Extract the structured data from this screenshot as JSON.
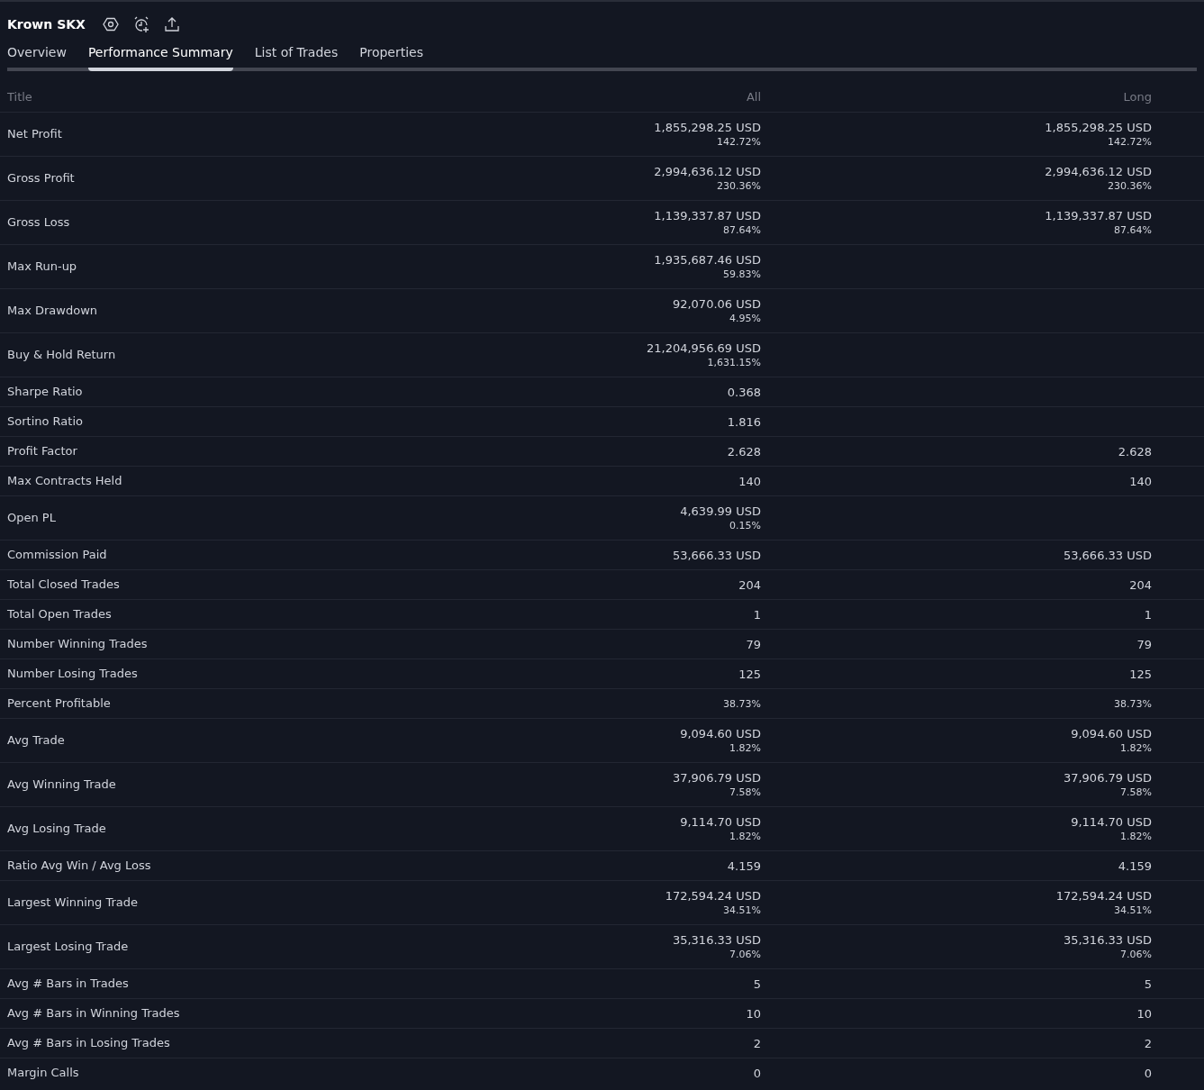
{
  "header": {
    "title": "Krown SKX"
  },
  "tabs": [
    {
      "label": "Overview",
      "selected": false
    },
    {
      "label": "Performance Summary",
      "selected": true
    },
    {
      "label": "List of Trades",
      "selected": false
    },
    {
      "label": "Properties",
      "selected": false
    }
  ],
  "table": {
    "columns": [
      "Title",
      "All",
      "Long"
    ],
    "rows": [
      {
        "title": "Net Profit",
        "all": {
          "value": "1,855,298.25 USD",
          "percent": "142.72%"
        },
        "long": {
          "value": "1,855,298.25 USD",
          "percent": "142.72%"
        }
      },
      {
        "title": "Gross Profit",
        "all": {
          "value": "2,994,636.12 USD",
          "percent": "230.36%"
        },
        "long": {
          "value": "2,994,636.12 USD",
          "percent": "230.36%"
        }
      },
      {
        "title": "Gross Loss",
        "all": {
          "value": "1,139,337.87 USD",
          "percent": "87.64%"
        },
        "long": {
          "value": "1,139,337.87 USD",
          "percent": "87.64%"
        }
      },
      {
        "title": "Max Run-up",
        "all": {
          "value": "1,935,687.46 USD",
          "percent": "59.83%"
        }
      },
      {
        "title": "Max Drawdown",
        "all": {
          "value": "92,070.06 USD",
          "percent": "4.95%"
        }
      },
      {
        "title": "Buy & Hold Return",
        "all": {
          "value": "21,204,956.69 USD",
          "percent": "1,631.15%"
        }
      },
      {
        "title": "Sharpe Ratio",
        "all": {
          "value": "0.368"
        }
      },
      {
        "title": "Sortino Ratio",
        "all": {
          "value": "1.816"
        }
      },
      {
        "title": "Profit Factor",
        "all": {
          "value": "2.628"
        },
        "long": {
          "value": "2.628"
        }
      },
      {
        "title": "Max Contracts Held",
        "all": {
          "value": "140"
        },
        "long": {
          "value": "140"
        }
      },
      {
        "title": "Open PL",
        "all": {
          "value": "4,639.99 USD",
          "percent": "0.15%"
        }
      },
      {
        "title": "Commission Paid",
        "all": {
          "value": "53,666.33 USD"
        },
        "long": {
          "value": "53,666.33 USD"
        }
      },
      {
        "title": "Total Closed Trades",
        "all": {
          "value": "204"
        },
        "long": {
          "value": "204"
        }
      },
      {
        "title": "Total Open Trades",
        "all": {
          "value": "1"
        },
        "long": {
          "value": "1"
        }
      },
      {
        "title": "Number Winning Trades",
        "all": {
          "value": "79"
        },
        "long": {
          "value": "79"
        }
      },
      {
        "title": "Number Losing Trades",
        "all": {
          "value": "125"
        },
        "long": {
          "value": "125"
        }
      },
      {
        "title": "Percent Profitable",
        "all": {
          "percent": "38.73%"
        },
        "long": {
          "percent": "38.73%"
        }
      },
      {
        "title": "Avg Trade",
        "all": {
          "value": "9,094.60 USD",
          "percent": "1.82%"
        },
        "long": {
          "value": "9,094.60 USD",
          "percent": "1.82%"
        }
      },
      {
        "title": "Avg Winning Trade",
        "all": {
          "value": "37,906.79 USD",
          "percent": "7.58%"
        },
        "long": {
          "value": "37,906.79 USD",
          "percent": "7.58%"
        }
      },
      {
        "title": "Avg Losing Trade",
        "all": {
          "value": "9,114.70 USD",
          "percent": "1.82%"
        },
        "long": {
          "value": "9,114.70 USD",
          "percent": "1.82%"
        }
      },
      {
        "title": "Ratio Avg Win / Avg Loss",
        "all": {
          "value": "4.159"
        },
        "long": {
          "value": "4.159"
        }
      },
      {
        "title": "Largest Winning Trade",
        "all": {
          "value": "172,594.24 USD",
          "percent": "34.51%"
        },
        "long": {
          "value": "172,594.24 USD",
          "percent": "34.51%"
        }
      },
      {
        "title": "Largest Losing Trade",
        "all": {
          "value": "35,316.33 USD",
          "percent": "7.06%"
        },
        "long": {
          "value": "35,316.33 USD",
          "percent": "7.06%"
        }
      },
      {
        "title": "Avg # Bars in Trades",
        "all": {
          "value": "5"
        },
        "long": {
          "value": "5"
        }
      },
      {
        "title": "Avg # Bars in Winning Trades",
        "all": {
          "value": "10"
        },
        "long": {
          "value": "10"
        }
      },
      {
        "title": "Avg # Bars in Losing Trades",
        "all": {
          "value": "2"
        },
        "long": {
          "value": "2"
        }
      },
      {
        "title": "Margin Calls",
        "all": {
          "value": "0"
        },
        "long": {
          "value": "0"
        }
      }
    ]
  }
}
